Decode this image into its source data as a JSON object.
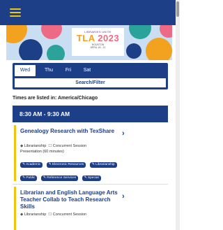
{
  "header": {
    "menu_icon": "hamburger-icon"
  },
  "banner": {
    "logo_top": "LIBRARIES UNITE",
    "logo_main": "TLA",
    "logo_year": "2023",
    "logo_city": "HOUSTON",
    "logo_dates": "APRIL 18 - 21"
  },
  "tabs": [
    {
      "label": "Wed",
      "active": true
    },
    {
      "label": "Thu",
      "active": false
    },
    {
      "label": "Fri",
      "active": false
    },
    {
      "label": "Sat",
      "active": false
    }
  ],
  "filter_label": "Search/Filter",
  "timezone_note": "Times are listed in: America/Chicago",
  "time_slot": "8:30 AM - 9:30 AM",
  "sessions": [
    {
      "title": "Genealogy Research with TexShare",
      "track": "Librarianship",
      "type": "Concurrent Session",
      "format": "Presentation (60 minutes)",
      "tags": [
        "Academic",
        "Electronic Resources",
        "Librarianship",
        "Public",
        "Reference Services",
        "Special"
      ]
    },
    {
      "title": "Librarian and English Language Arts Teacher Collab to Teach Research Skills",
      "track": "Librarianship",
      "type": "Concurrent Session"
    }
  ],
  "colors": {
    "primary": "#1d3f87",
    "accent": "#f1c40f",
    "banner_bg": "#c9def2"
  }
}
